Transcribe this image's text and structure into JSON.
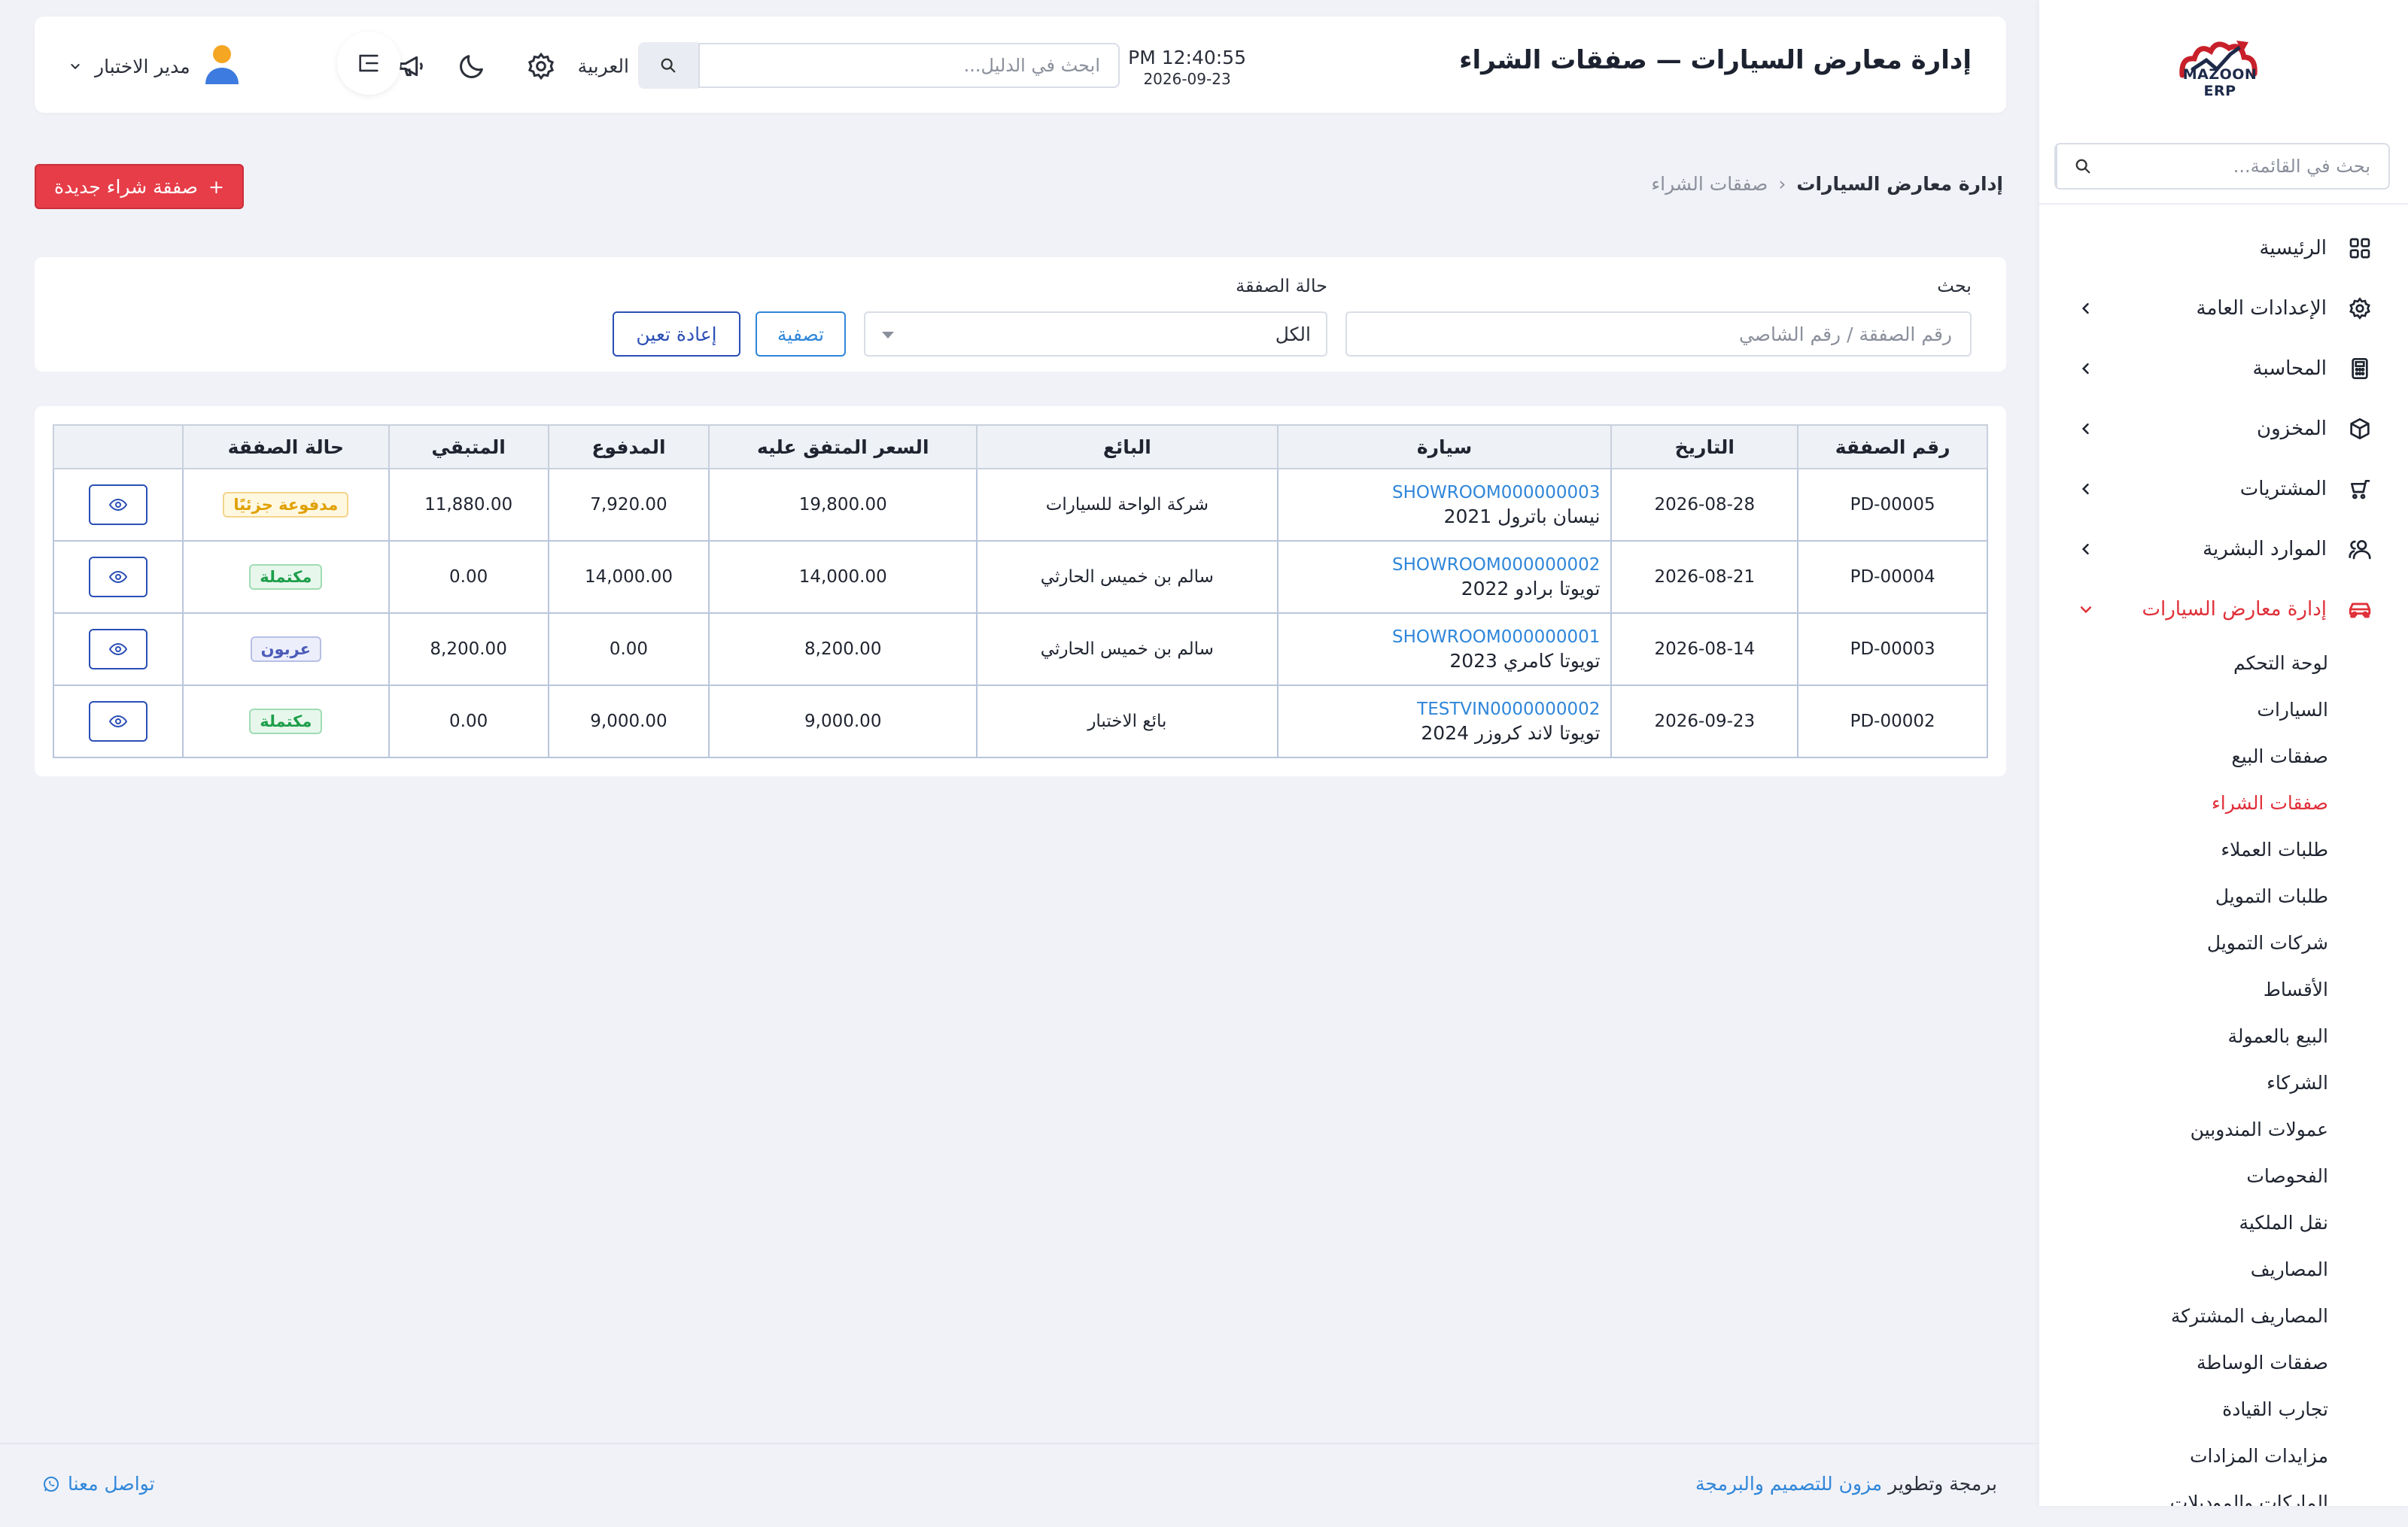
{
  "brand": {
    "logo_text": "MAZOON ERP",
    "accent": "#e0303a",
    "link_color": "#2f86d9"
  },
  "sidebar": {
    "search_placeholder": "بحث في القائمة...",
    "items": [
      {
        "label": "الرئيسية",
        "icon": "grid-icon",
        "has_children": false
      },
      {
        "label": "الإعدادات العامة",
        "icon": "gear-icon",
        "has_children": true
      },
      {
        "label": "المحاسبة",
        "icon": "calculator-icon",
        "has_children": true
      },
      {
        "label": "المخزون",
        "icon": "box-icon",
        "has_children": true
      },
      {
        "label": "المشتريات",
        "icon": "cart-icon",
        "has_children": true
      },
      {
        "label": "الموارد البشرية",
        "icon": "users-icon",
        "has_children": true
      },
      {
        "label": "إدارة معارض السيارات",
        "icon": "car-icon",
        "has_children": true,
        "expanded": true
      }
    ],
    "sub_items": [
      "لوحة التحكم",
      "السيارات",
      "صفقات البيع",
      "صفقات الشراء",
      "طلبات العملاء",
      "طلبات التمويل",
      "شركات التمويل",
      "الأقساط",
      "البيع بالعمولة",
      "الشركاء",
      "عمولات المندوبين",
      "الفحوصات",
      "نقل الملكية",
      "المصاريف",
      "المصاريف المشتركة",
      "صفقات الوساطة",
      "تجارب القيادة",
      "مزايدات المزادات",
      "الماركات والموديلات"
    ],
    "current_sub": "صفقات الشراء"
  },
  "header": {
    "title": "إدارة معارض السيارات — صفقات الشراء",
    "time": "PM 12:40:55",
    "date": "2026-09-23",
    "search_placeholder": "ابحث في الدليل...",
    "language": "العربية",
    "user_name": "مدير الاختبار"
  },
  "breadcrumb": {
    "root": "إدارة معارض السيارات",
    "separator": "‹",
    "current": "صفقات الشراء"
  },
  "new_button": {
    "label": "صفقة شراء جديدة",
    "icon": "+"
  },
  "filters": {
    "search_label": "بحث",
    "search_placeholder": "رقم الصفقة / رقم الشاصي",
    "status_label": "حالة الصفقة",
    "status_value": "الكل",
    "filter_button": "تصفية",
    "reset_button": "إعادة تعين"
  },
  "table": {
    "columns": [
      "رقم الصفقة",
      "التاريخ",
      "سيارة",
      "البائع",
      "السعر المتفق عليه",
      "المدفوع",
      "المتبقي",
      "حالة الصفقة",
      ""
    ],
    "rows": [
      {
        "deal_no": "PD-00005",
        "date": "2026-08-28",
        "vin": "SHOWROOM000000003",
        "model": "نيسان باترول 2021",
        "seller": "شركة الواحة للسيارات",
        "price": "19,800.00",
        "paid": "7,920.00",
        "remaining": "11,880.00",
        "status": "مدفوعة جزئيًا",
        "status_kind": "partial"
      },
      {
        "deal_no": "PD-00004",
        "date": "2026-08-21",
        "vin": "SHOWROOM000000002",
        "model": "تويوتا برادو 2022",
        "seller": "سالم بن خميس الحارثي",
        "price": "14,000.00",
        "paid": "14,000.00",
        "remaining": "0.00",
        "status": "مكتملة",
        "status_kind": "done"
      },
      {
        "deal_no": "PD-00003",
        "date": "2026-08-14",
        "vin": "SHOWROOM000000001",
        "model": "تويوتا كامري 2023",
        "seller": "سالم بن خميس الحارثي",
        "price": "8,200.00",
        "paid": "0.00",
        "remaining": "8,200.00",
        "status": "عربون",
        "status_kind": "deposit"
      },
      {
        "deal_no": "PD-00002",
        "date": "2026-09-23",
        "vin": "TESTVIN0000000002",
        "model": "تويوتا لاند كروزر 2024",
        "seller": "بائع الاختبار",
        "price": "9,000.00",
        "paid": "9,000.00",
        "remaining": "0.00",
        "status": "مكتملة",
        "status_kind": "done"
      }
    ]
  },
  "footer": {
    "credit_prefix": "برمجة وتطوير",
    "credit_link": "مزون للتصميم والبرمجة",
    "contact": "تواصل معنا"
  }
}
